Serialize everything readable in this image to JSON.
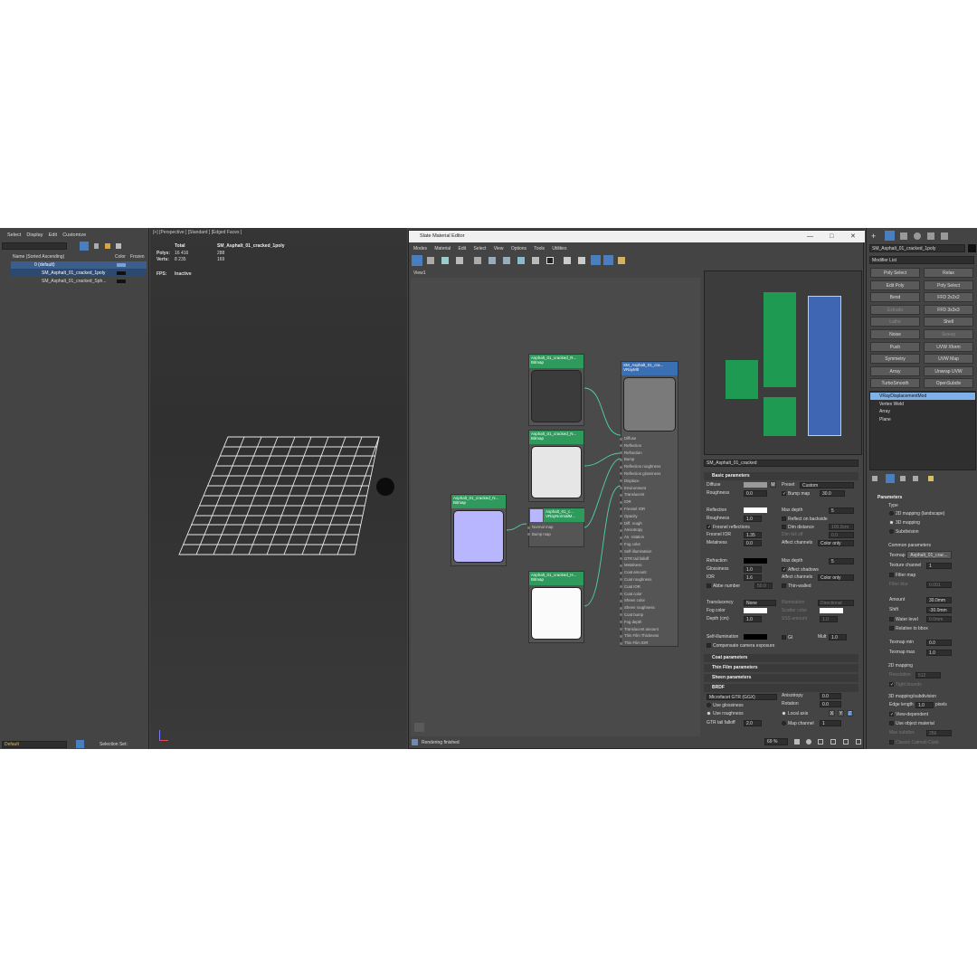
{
  "scene_explorer": {
    "menu": [
      "Select",
      "Display",
      "Edit",
      "Customize"
    ],
    "columns": {
      "name": "Name (Sorted Ascending)",
      "color": "Color",
      "frozen": "Frozen"
    },
    "layer": "0 (default)",
    "objects": [
      "SM_Asphalt_01_cracked_1poly",
      "SM_Asphalt_01_cracked_Sph..."
    ],
    "bottom": {
      "layer": "Default",
      "selection_set": "Selection Set:"
    }
  },
  "viewport": {
    "label": "[+] [Perspective ] [Standard ] [Edged Faces ]",
    "stats": {
      "total": "Total",
      "object": "SM_Asphalt_01_cracked_1poly",
      "polys_label": "Polys:",
      "polys_total": "16 416",
      "polys_obj": "288",
      "verts_label": "Verts:",
      "verts_total": "8 235",
      "verts_obj": "169",
      "fps_label": "FPS:",
      "fps_value": "Inactive"
    }
  },
  "sme": {
    "title": "Slate Material Editor",
    "menu": [
      "Modes",
      "Material",
      "Edit",
      "Select",
      "View",
      "Options",
      "Tools",
      "Utilities"
    ],
    "view_tab": "View1",
    "status": "Rendering finished",
    "zoom": "69 %",
    "nodes": {
      "n1": {
        "name": "Asphalt_01_cracked_N...",
        "type": "Bitmap"
      },
      "n2": {
        "name": "Asphalt_01_cracked_R...",
        "type": "Bitmap"
      },
      "n3": {
        "name": "Asphalt_01_cracked_N...",
        "type": "Bitmap"
      },
      "n4": {
        "name": "Asphalt_01_c...",
        "type": "VRayNormalM...",
        "slots": [
          "Normal map",
          "Bump map"
        ]
      },
      "n5": {
        "name": "Asphalt_01_cracked_H...",
        "type": "Bitmap"
      },
      "mtl": {
        "name": "SM_Asphalt_01_cra...",
        "type": "VRayMtl",
        "slots": [
          "Diffuse",
          "Reflection",
          "Refraction",
          "Bump",
          "Reflection roughness",
          "Reflection glossiness",
          "Displace",
          "Environment",
          "Translucent",
          "IOR",
          "Fresnel IOR",
          "Opacity",
          "Diff. rough",
          "Anisotropy",
          "An. rotation",
          "Fog color",
          "Self-illumination",
          "GTR tail falloff",
          "Metalness",
          "Coat amount",
          "Coat roughness",
          "Coat IOR",
          "Coat color",
          "Sheen color",
          "Sheen roughness",
          "Coat bump",
          "Fog depth",
          "Translucent amount",
          "Thin Film Thickness",
          "Thin Film IOR"
        ]
      }
    }
  },
  "params": {
    "material_name": "SM_Asphalt_01_cracked",
    "basic_header": "Basic parameters",
    "diffuse": "Diffuse",
    "roughness": "Roughness",
    "roughness_val": "0.0",
    "preset": "Preset",
    "preset_val": "Custom",
    "bump_map": "Bump map",
    "bump_val": "30.0",
    "reflection": "Reflection",
    "refl_rough": "Roughness",
    "refl_rough_val": "1.0",
    "fresnel": "Fresnel reflections",
    "fresnel_ior": "Fresnel IOR",
    "fresnel_ior_val": "1.35",
    "metalness": "Metalness",
    "metalness_val": "0.0",
    "max_depth": "Max depth",
    "max_depth_val": "5",
    "reflect_backside": "Reflect on backside",
    "dim_distance": "Dim distance",
    "dim_distance_val": "100.0cm",
    "dim_falloff": "Dim fall off",
    "dim_falloff_val": "0.0",
    "affect_channels": "Affect channels",
    "affect_val": "Color only",
    "refraction": "Refraction",
    "glossiness": "Glossiness",
    "gloss_val": "1.0",
    "ior": "IOR",
    "ior_val": "1.6",
    "abbe": "Abbe number",
    "abbe_val": "50.0",
    "max_depth2_val": "5",
    "affect_shadows": "Affect shadows",
    "affect_channels2_val": "Color only",
    "thin_walled": "Thin-walled",
    "translucency": "Translucency",
    "translucency_val": "None",
    "illumination": "Illumination",
    "illum_val": "Directional",
    "fog_color": "Fog color",
    "scatter_color": "Scatter color",
    "depth": "Depth (cm)",
    "depth_val": "1.0",
    "sss_amount": "SSS amount",
    "sss_val": "1.0",
    "self_illum": "Self-illumination",
    "gi": "GI",
    "mult": "Mult",
    "mult_val": "1.0",
    "compensate": "Compensate camera exposure",
    "coat_header": "Coat parameters",
    "thin_header": "Thin Film parameters",
    "sheen_header": "Sheen parameters",
    "brdf_header": "BRDF",
    "brdf_type": "Microfacet GTR (GGX)",
    "use_glossiness": "Use glossiness",
    "use_roughness": "Use roughness",
    "gtr_tail": "GTR tail falloff",
    "gtr_val": "2.0",
    "anisotropy": "Anisotropy",
    "aniso_val": "0.0",
    "rotation": "Rotation",
    "rot_val": "0.0",
    "local_axis": "Local axis",
    "axes": [
      "X",
      "Y",
      "Z"
    ],
    "map_channel": "Map channel",
    "map_channel_val": "1"
  },
  "modifier": {
    "object_name": "SM_Asphalt_01_cracked_1poly",
    "list_label": "Modifier List",
    "buttons": [
      [
        "Poly Select",
        "Relax"
      ],
      [
        "Edit Poly",
        "Poly Select"
      ],
      [
        "Bend",
        "FFD 2x2x2"
      ],
      [
        "Extrude",
        "FFD 3x3x3"
      ],
      [
        "Lathe",
        "Shell"
      ],
      [
        "Noise",
        "Sweep"
      ],
      [
        "Push",
        "UVW Xform"
      ],
      [
        "Symmetry",
        "UVW Map"
      ],
      [
        "Array",
        "Unwrap UVW"
      ],
      [
        "TurboSmooth",
        "OpenSubdiv"
      ]
    ],
    "stack": [
      "VRayDisplacementMod",
      "Vertex Weld",
      "Array",
      "Plane"
    ],
    "params_header": "Parameters",
    "type": "Type",
    "mapping": [
      "2D mapping (landscape)",
      "3D mapping",
      "Subdivision"
    ],
    "common": "Common parameters",
    "texmap": "Texmap",
    "texmap_val": "Asphalt_01_crac...",
    "texture_channel": "Texture channel",
    "tex_ch_val": "1",
    "filter_map": "Filter map",
    "filter_blur": "Filter blur",
    "filter_blur_val": "0.001",
    "amount": "Amount",
    "amount_val": "30.0mm",
    "shift": "Shift",
    "shift_val": "-30.0mm",
    "water_level": "Water level",
    "water_val": "0.0mm",
    "relative": "Relative to bbox",
    "texmap_min": "Texmap min",
    "texmap_min_val": "0.0",
    "texmap_max": "Texmap max",
    "texmap_max_val": "1.0",
    "map2d": "2D mapping",
    "resolution": "Resolution",
    "resolution_val": "512",
    "tight": "Tight bounds",
    "map3d": "3D mapping/subdivision",
    "edge_length": "Edge length",
    "edge_val": "1.0",
    "pixels": "pixels",
    "view_dependent": "View-dependent",
    "use_object_mtl": "Use object material",
    "max_subdivs": "Max subdivs",
    "max_subdivs_val": "256",
    "catmull": "Classic Catmull-Clark"
  },
  "colors": {
    "green": "#1e9a52",
    "blue": "#3f66b2",
    "node_green": "#2e9b5d"
  }
}
